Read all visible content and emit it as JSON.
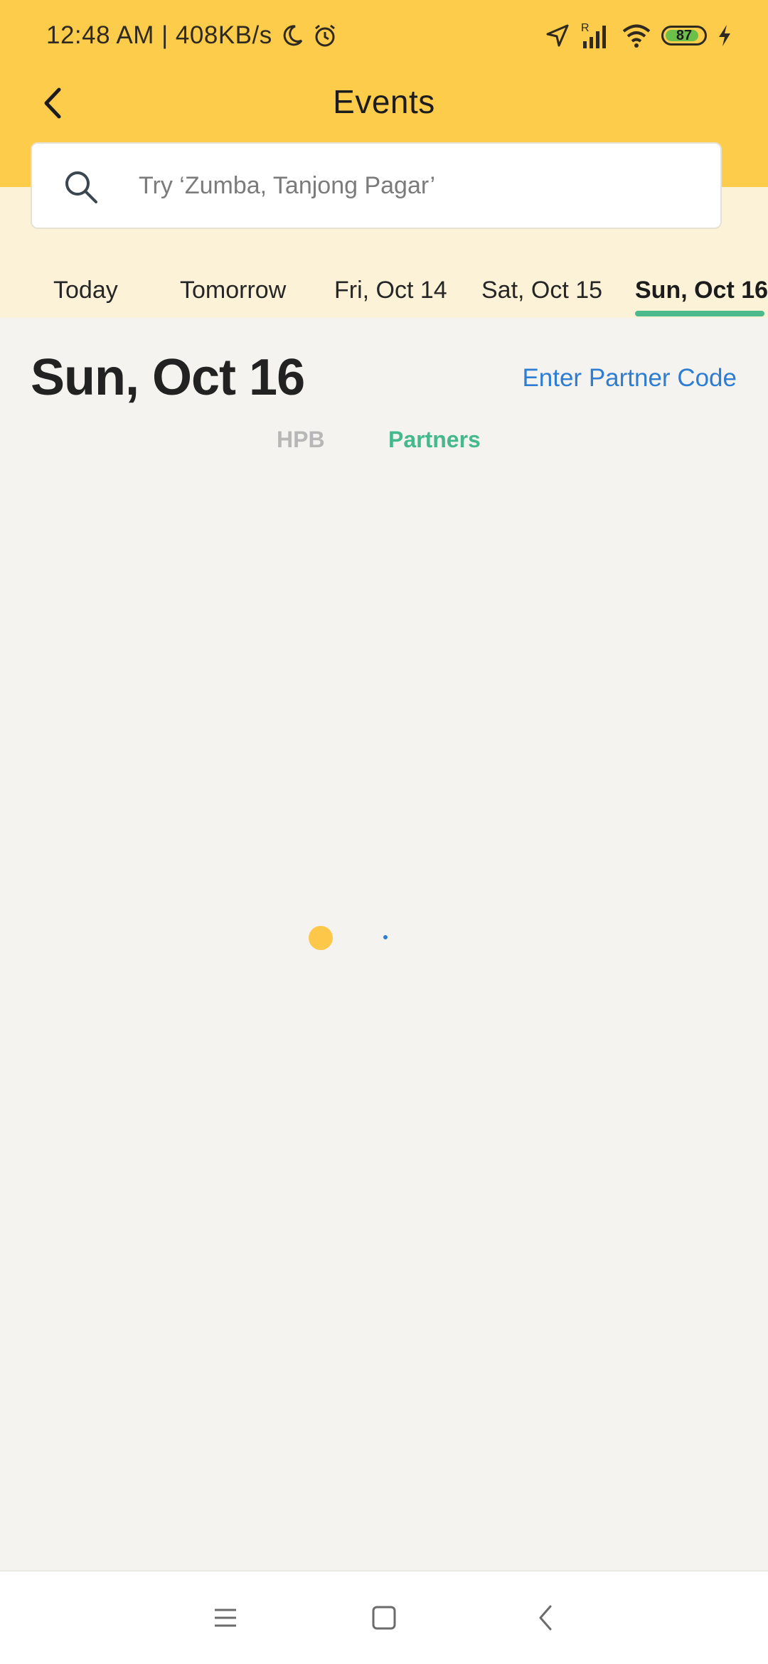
{
  "status_bar": {
    "time_speed": "12:48 AM | 408KB/s",
    "battery_level": "87",
    "roaming_indicator": "R",
    "icons": [
      "moon-icon",
      "alarm-icon",
      "location-arrow-icon",
      "signal-icon",
      "wifi-icon",
      "battery-icon",
      "charging-icon"
    ]
  },
  "header": {
    "title": "Events",
    "back_icon": "chevron-left-icon"
  },
  "search": {
    "placeholder": "Try ‘Zumba, Tanjong Pagar’",
    "icon": "search-icon"
  },
  "date_tabs": [
    {
      "label": "Today",
      "active": false
    },
    {
      "label": "Tomorrow",
      "active": false
    },
    {
      "label": "Fri, Oct 14",
      "active": false
    },
    {
      "label": "Sat, Oct 15",
      "active": false
    },
    {
      "label": "Sun, Oct 16",
      "active": true
    }
  ],
  "content": {
    "date_heading": "Sun, Oct 16",
    "partner_code_link": "Enter Partner Code",
    "sub_tabs": [
      {
        "label": "HPB",
        "active": false
      },
      {
        "label": "Partners",
        "active": true
      }
    ]
  },
  "nav_bar": {
    "buttons": [
      "menu-icon",
      "home-square-icon",
      "back-chevron-icon"
    ]
  },
  "colors": {
    "header_bg": "#fecc4b",
    "date_strip_bg": "#fbf2d8",
    "content_bg": "#f4f3ef",
    "accent_green": "#4dba8e",
    "link_blue": "#2d7dd2",
    "loader_yellow": "#fdc84a"
  }
}
